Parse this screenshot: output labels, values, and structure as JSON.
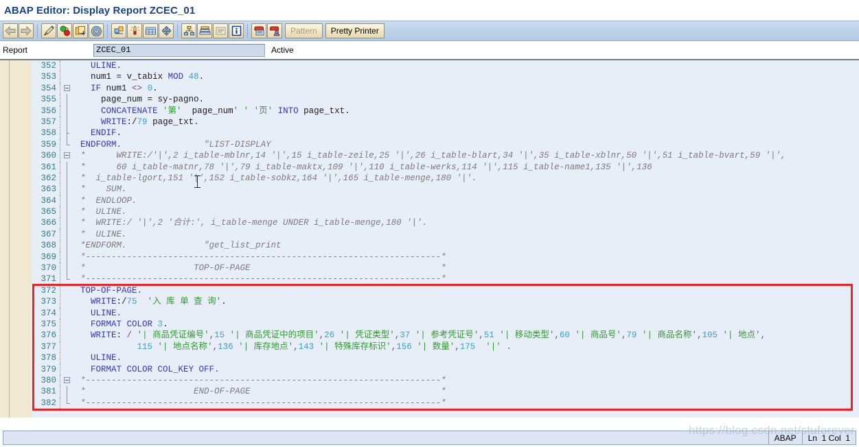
{
  "window": {
    "title": "ABAP Editor: Display Report ZCEC_01"
  },
  "toolbar": {
    "buttons": [
      {
        "name": "back-icon",
        "tip": "Back"
      },
      {
        "name": "forward-icon",
        "tip": "Forward"
      },
      {
        "name": "check-syntax-icon",
        "tip": "Check"
      },
      {
        "name": "activate-icon",
        "tip": "Activate"
      },
      {
        "name": "copy-object-icon",
        "tip": "Copy"
      },
      {
        "name": "where-used-icon",
        "tip": "Where-Used List"
      },
      {
        "name": "display-object-list-icon",
        "tip": "Object List"
      },
      {
        "name": "debug-icon",
        "tip": "Debugging"
      },
      {
        "name": "table-display-icon",
        "tip": "Display Table"
      },
      {
        "name": "navigate-icon",
        "tip": "Navigate"
      },
      {
        "name": "hierarchy-icon",
        "tip": "Hierarchy"
      },
      {
        "name": "stack-icon",
        "tip": "Stack"
      },
      {
        "name": "list-icon",
        "tip": "List"
      },
      {
        "name": "info-icon",
        "tip": "Information"
      },
      {
        "name": "insert-statement-icon",
        "tip": "Insert Statement"
      },
      {
        "name": "user-object-icon",
        "tip": "User Object"
      }
    ],
    "pattern_label": "Pattern",
    "pretty_printer_label": "Pretty Printer"
  },
  "report_bar": {
    "label": "Report",
    "value": "ZCEC_01",
    "placeholder": "",
    "status": "Active"
  },
  "statusbar": {
    "language": "ABAP",
    "position": "Ln  1 Col  1"
  },
  "watermark": "https://blog.csdn.net/stuforever",
  "colors": {
    "keyword": "#3333cc",
    "number": "#3aa0d0",
    "string": "#2e9b2e",
    "comment": "#7b7b7b",
    "operator": "#7a3b9e",
    "line_number": "#2e7d86",
    "highlight_box": "#ee2222",
    "editor_background": "#e8eef7",
    "gutter_background": "#f0e8d0",
    "toolbar_background": "#bed2ea",
    "title_color": "#15428b"
  },
  "code": {
    "first_line_number": 352,
    "lines": [
      {
        "n": 352,
        "fold": "none",
        "tokens": [
          {
            "t": "  ",
            "c": "plain"
          },
          {
            "t": "ULINE",
            "c": "kw"
          },
          {
            "t": ".",
            "c": "kw"
          }
        ]
      },
      {
        "n": 353,
        "fold": "none",
        "tokens": [
          {
            "t": "  ",
            "c": "plain"
          },
          {
            "t": "num1",
            "c": "plain"
          },
          {
            "t": " ",
            "c": "plain"
          },
          {
            "t": "=",
            "c": "plain"
          },
          {
            "t": " v_tabix ",
            "c": "plain"
          },
          {
            "t": "MOD",
            "c": "kw"
          },
          {
            "t": " ",
            "c": "plain"
          },
          {
            "t": "48",
            "c": "num"
          },
          {
            "t": ".",
            "c": "plain"
          }
        ]
      },
      {
        "n": 354,
        "fold": "open",
        "tokens": [
          {
            "t": "  ",
            "c": "plain"
          },
          {
            "t": "IF",
            "c": "kw"
          },
          {
            "t": " num1 ",
            "c": "plain"
          },
          {
            "t": "<>",
            "c": "op"
          },
          {
            "t": " ",
            "c": "plain"
          },
          {
            "t": "0",
            "c": "num"
          },
          {
            "t": ".",
            "c": "plain"
          }
        ]
      },
      {
        "n": 355,
        "fold": "bar",
        "tokens": [
          {
            "t": "    page_num = sy-pagno.",
            "c": "plain"
          }
        ]
      },
      {
        "n": 356,
        "fold": "bar",
        "tokens": [
          {
            "t": "    ",
            "c": "plain"
          },
          {
            "t": "CONCATENATE",
            "c": "kw"
          },
          {
            "t": " ",
            "c": "plain"
          },
          {
            "t": "'第'",
            "c": "str"
          },
          {
            "t": "  page_num",
            "c": "plain"
          },
          {
            "t": "' '",
            "c": "str"
          },
          {
            "t": " ",
            "c": "plain"
          },
          {
            "t": "'页'",
            "c": "str"
          },
          {
            "t": " ",
            "c": "plain"
          },
          {
            "t": "INTO",
            "c": "kw"
          },
          {
            "t": " page_txt.",
            "c": "plain"
          }
        ]
      },
      {
        "n": 357,
        "fold": "bar",
        "tokens": [
          {
            "t": "    ",
            "c": "plain"
          },
          {
            "t": "WRITE",
            "c": "kw"
          },
          {
            "t": ":/",
            "c": "plain"
          },
          {
            "t": "79",
            "c": "num"
          },
          {
            "t": " page_txt.",
            "c": "plain"
          }
        ]
      },
      {
        "n": 358,
        "fold": "tick",
        "tokens": [
          {
            "t": "  ",
            "c": "plain"
          },
          {
            "t": "ENDIF",
            "c": "kw"
          },
          {
            "t": ".",
            "c": "plain"
          }
        ]
      },
      {
        "n": 359,
        "fold": "close",
        "tokens": [
          {
            "t": "",
            "c": "plain"
          },
          {
            "t": "ENDFORM",
            "c": "kw"
          },
          {
            "t": ".",
            "c": "kw"
          },
          {
            "t": "                \"LIST-DISPLAY",
            "c": "dq"
          }
        ]
      },
      {
        "n": 360,
        "fold": "open",
        "tokens": [
          {
            "t": "*      WRITE:/'|',2 i_table-mblnr,14 '|',15 i_table-zeile,25 '|',26 i_table-blart,34 '|',35 i_table-xblnr,50 '|',51 i_table-bvart,59 '|',",
            "c": "cmt"
          }
        ]
      },
      {
        "n": 361,
        "fold": "bar",
        "tokens": [
          {
            "t": "*      60 i_table-matnr,78 '|',79 i_table-maktx,109 '|',110 i_table-werks,114 '|',115 i_table-name1,135 '|',136",
            "c": "cmt"
          }
        ]
      },
      {
        "n": 362,
        "fold": "bar",
        "tokens": [
          {
            "t": "*  i_table-lgort,151 '|',152 i_table-sobkz,164 '|',165 i_table-menge,180 '|'.",
            "c": "cmt"
          }
        ]
      },
      {
        "n": 363,
        "fold": "bar",
        "tokens": [
          {
            "t": "*    SUM.",
            "c": "cmt"
          }
        ]
      },
      {
        "n": 364,
        "fold": "bar",
        "tokens": [
          {
            "t": "*  ENDLOOP.",
            "c": "cmt"
          }
        ]
      },
      {
        "n": 365,
        "fold": "bar",
        "tokens": [
          {
            "t": "*  ULINE.",
            "c": "cmt"
          }
        ]
      },
      {
        "n": 366,
        "fold": "bar",
        "tokens": [
          {
            "t": "*  WRITE:/ '|',2 '合计:', i_table-menge UNDER i_table-menge,180 '|'.",
            "c": "cmt"
          }
        ]
      },
      {
        "n": 367,
        "fold": "bar",
        "tokens": [
          {
            "t": "*  ULINE.",
            "c": "cmt"
          }
        ]
      },
      {
        "n": 368,
        "fold": "bar",
        "tokens": [
          {
            "t": "*ENDFORM.               \"get_list_print",
            "c": "cmt"
          }
        ]
      },
      {
        "n": 369,
        "fold": "bar",
        "tokens": [
          {
            "t": "*---------------------------------------------------------------------*",
            "c": "cmt"
          }
        ]
      },
      {
        "n": 370,
        "fold": "bar",
        "tokens": [
          {
            "t": "*                     TOP-OF-PAGE                                     *",
            "c": "cmt"
          }
        ]
      },
      {
        "n": 371,
        "fold": "close",
        "tokens": [
          {
            "t": "*---------------------------------------------------------------------*",
            "c": "cmt"
          }
        ]
      },
      {
        "n": 372,
        "fold": "none",
        "tokens": [
          {
            "t": "",
            "c": "plain"
          },
          {
            "t": "TOP-OF-PAGE",
            "c": "kw"
          },
          {
            "t": ".",
            "c": "kw"
          }
        ]
      },
      {
        "n": 373,
        "fold": "none",
        "tokens": [
          {
            "t": "  ",
            "c": "plain"
          },
          {
            "t": "WRITE",
            "c": "kw"
          },
          {
            "t": ":/",
            "c": "plain"
          },
          {
            "t": "75",
            "c": "num"
          },
          {
            "t": "  ",
            "c": "plain"
          },
          {
            "t": "'入 库 单 查 询'",
            "c": "str"
          },
          {
            "t": ".",
            "c": "plain"
          }
        ]
      },
      {
        "n": 374,
        "fold": "none",
        "tokens": [
          {
            "t": "  ",
            "c": "plain"
          },
          {
            "t": "ULINE",
            "c": "kw"
          },
          {
            "t": ".",
            "c": "kw"
          }
        ]
      },
      {
        "n": 375,
        "fold": "none",
        "tokens": [
          {
            "t": "  ",
            "c": "plain"
          },
          {
            "t": "FORMAT COLOR",
            "c": "kw"
          },
          {
            "t": " ",
            "c": "plain"
          },
          {
            "t": "3",
            "c": "num"
          },
          {
            "t": ".",
            "c": "plain"
          }
        ]
      },
      {
        "n": 376,
        "fold": "none",
        "tokens": [
          {
            "t": "  ",
            "c": "plain"
          },
          {
            "t": "WRITE",
            "c": "kw"
          },
          {
            "t": ": ",
            "c": "plain"
          },
          {
            "t": "/",
            "c": "op"
          },
          {
            "t": " ",
            "c": "plain"
          },
          {
            "t": "'| 商品凭证编号'",
            "c": "str"
          },
          {
            "t": ",",
            "c": "op"
          },
          {
            "t": "15",
            "c": "num"
          },
          {
            "t": " ",
            "c": "plain"
          },
          {
            "t": "'| 商品凭证中的项目'",
            "c": "str"
          },
          {
            "t": ",",
            "c": "op"
          },
          {
            "t": "26",
            "c": "num"
          },
          {
            "t": " ",
            "c": "plain"
          },
          {
            "t": "'| 凭证类型'",
            "c": "str"
          },
          {
            "t": ",",
            "c": "op"
          },
          {
            "t": "37",
            "c": "num"
          },
          {
            "t": " ",
            "c": "plain"
          },
          {
            "t": "'| 参考凭证号'",
            "c": "str"
          },
          {
            "t": ",",
            "c": "op"
          },
          {
            "t": "51",
            "c": "num"
          },
          {
            "t": " ",
            "c": "plain"
          },
          {
            "t": "'| 移动类型'",
            "c": "str"
          },
          {
            "t": ",",
            "c": "op"
          },
          {
            "t": "60",
            "c": "num"
          },
          {
            "t": " ",
            "c": "plain"
          },
          {
            "t": "'| 商品号'",
            "c": "str"
          },
          {
            "t": ",",
            "c": "op"
          },
          {
            "t": "79",
            "c": "num"
          },
          {
            "t": " ",
            "c": "plain"
          },
          {
            "t": "'| 商品名称'",
            "c": "str"
          },
          {
            "t": ",",
            "c": "op"
          },
          {
            "t": "105",
            "c": "num"
          },
          {
            "t": " ",
            "c": "plain"
          },
          {
            "t": "'| 地点'",
            "c": "str"
          },
          {
            "t": ",",
            "c": "op"
          }
        ]
      },
      {
        "n": 377,
        "fold": "none",
        "tokens": [
          {
            "t": "           ",
            "c": "plain"
          },
          {
            "t": "115",
            "c": "num"
          },
          {
            "t": " ",
            "c": "plain"
          },
          {
            "t": "'| 地点名称'",
            "c": "str"
          },
          {
            "t": ",",
            "c": "op"
          },
          {
            "t": "136",
            "c": "num"
          },
          {
            "t": " ",
            "c": "plain"
          },
          {
            "t": "'| 库存地点'",
            "c": "str"
          },
          {
            "t": ",",
            "c": "op"
          },
          {
            "t": "143",
            "c": "num"
          },
          {
            "t": " ",
            "c": "plain"
          },
          {
            "t": "'| 特殊库存标识'",
            "c": "str"
          },
          {
            "t": ",",
            "c": "op"
          },
          {
            "t": "156",
            "c": "num"
          },
          {
            "t": " ",
            "c": "plain"
          },
          {
            "t": "'| 数量'",
            "c": "str"
          },
          {
            "t": ",",
            "c": "op"
          },
          {
            "t": "175",
            "c": "num"
          },
          {
            "t": "  ",
            "c": "plain"
          },
          {
            "t": "'|'",
            "c": "str"
          },
          {
            "t": " ",
            "c": "plain"
          },
          {
            "t": ".",
            "c": "op"
          }
        ]
      },
      {
        "n": 378,
        "fold": "none",
        "tokens": [
          {
            "t": "  ",
            "c": "plain"
          },
          {
            "t": "ULINE",
            "c": "kw"
          },
          {
            "t": ".",
            "c": "kw"
          }
        ]
      },
      {
        "n": 379,
        "fold": "none",
        "tokens": [
          {
            "t": "  ",
            "c": "plain"
          },
          {
            "t": "FORMAT COLOR COL_KEY OFF",
            "c": "kw"
          },
          {
            "t": ".",
            "c": "kw"
          }
        ]
      },
      {
        "n": 380,
        "fold": "open",
        "tokens": [
          {
            "t": "*---------------------------------------------------------------------*",
            "c": "cmt"
          }
        ]
      },
      {
        "n": 381,
        "fold": "bar",
        "tokens": [
          {
            "t": "*                     END-OF-PAGE                                     *",
            "c": "cmt"
          }
        ]
      },
      {
        "n": 382,
        "fold": "close",
        "tokens": [
          {
            "t": "*---------------------------------------------------------------------*",
            "c": "cmt"
          }
        ]
      }
    ]
  }
}
